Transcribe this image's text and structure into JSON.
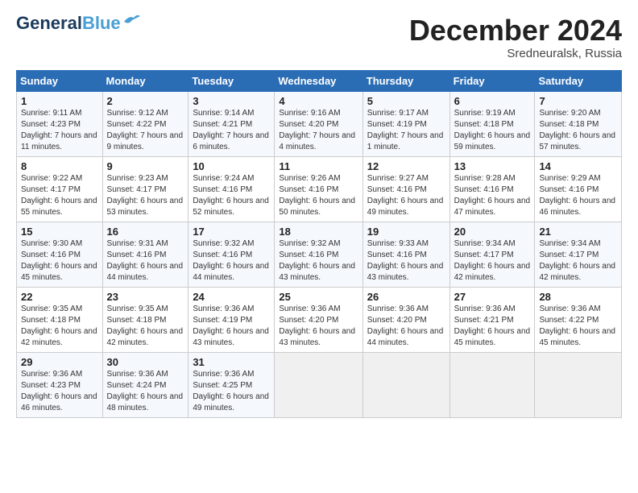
{
  "header": {
    "logo_general": "General",
    "logo_blue": "Blue",
    "month": "December 2024",
    "location": "Sredneuralsk, Russia"
  },
  "weekdays": [
    "Sunday",
    "Monday",
    "Tuesday",
    "Wednesday",
    "Thursday",
    "Friday",
    "Saturday"
  ],
  "weeks": [
    [
      {
        "day": "1",
        "sunrise": "9:11 AM",
        "sunset": "4:23 PM",
        "daylight": "7 hours and 11 minutes."
      },
      {
        "day": "2",
        "sunrise": "9:12 AM",
        "sunset": "4:22 PM",
        "daylight": "7 hours and 9 minutes."
      },
      {
        "day": "3",
        "sunrise": "9:14 AM",
        "sunset": "4:21 PM",
        "daylight": "7 hours and 6 minutes."
      },
      {
        "day": "4",
        "sunrise": "9:16 AM",
        "sunset": "4:20 PM",
        "daylight": "7 hours and 4 minutes."
      },
      {
        "day": "5",
        "sunrise": "9:17 AM",
        "sunset": "4:19 PM",
        "daylight": "7 hours and 1 minute."
      },
      {
        "day": "6",
        "sunrise": "9:19 AM",
        "sunset": "4:18 PM",
        "daylight": "6 hours and 59 minutes."
      },
      {
        "day": "7",
        "sunrise": "9:20 AM",
        "sunset": "4:18 PM",
        "daylight": "6 hours and 57 minutes."
      }
    ],
    [
      {
        "day": "8",
        "sunrise": "9:22 AM",
        "sunset": "4:17 PM",
        "daylight": "6 hours and 55 minutes."
      },
      {
        "day": "9",
        "sunrise": "9:23 AM",
        "sunset": "4:17 PM",
        "daylight": "6 hours and 53 minutes."
      },
      {
        "day": "10",
        "sunrise": "9:24 AM",
        "sunset": "4:16 PM",
        "daylight": "6 hours and 52 minutes."
      },
      {
        "day": "11",
        "sunrise": "9:26 AM",
        "sunset": "4:16 PM",
        "daylight": "6 hours and 50 minutes."
      },
      {
        "day": "12",
        "sunrise": "9:27 AM",
        "sunset": "4:16 PM",
        "daylight": "6 hours and 49 minutes."
      },
      {
        "day": "13",
        "sunrise": "9:28 AM",
        "sunset": "4:16 PM",
        "daylight": "6 hours and 47 minutes."
      },
      {
        "day": "14",
        "sunrise": "9:29 AM",
        "sunset": "4:16 PM",
        "daylight": "6 hours and 46 minutes."
      }
    ],
    [
      {
        "day": "15",
        "sunrise": "9:30 AM",
        "sunset": "4:16 PM",
        "daylight": "6 hours and 45 minutes."
      },
      {
        "day": "16",
        "sunrise": "9:31 AM",
        "sunset": "4:16 PM",
        "daylight": "6 hours and 44 minutes."
      },
      {
        "day": "17",
        "sunrise": "9:32 AM",
        "sunset": "4:16 PM",
        "daylight": "6 hours and 44 minutes."
      },
      {
        "day": "18",
        "sunrise": "9:32 AM",
        "sunset": "4:16 PM",
        "daylight": "6 hours and 43 minutes."
      },
      {
        "day": "19",
        "sunrise": "9:33 AM",
        "sunset": "4:16 PM",
        "daylight": "6 hours and 43 minutes."
      },
      {
        "day": "20",
        "sunrise": "9:34 AM",
        "sunset": "4:17 PM",
        "daylight": "6 hours and 42 minutes."
      },
      {
        "day": "21",
        "sunrise": "9:34 AM",
        "sunset": "4:17 PM",
        "daylight": "6 hours and 42 minutes."
      }
    ],
    [
      {
        "day": "22",
        "sunrise": "9:35 AM",
        "sunset": "4:18 PM",
        "daylight": "6 hours and 42 minutes."
      },
      {
        "day": "23",
        "sunrise": "9:35 AM",
        "sunset": "4:18 PM",
        "daylight": "6 hours and 42 minutes."
      },
      {
        "day": "24",
        "sunrise": "9:36 AM",
        "sunset": "4:19 PM",
        "daylight": "6 hours and 43 minutes."
      },
      {
        "day": "25",
        "sunrise": "9:36 AM",
        "sunset": "4:20 PM",
        "daylight": "6 hours and 43 minutes."
      },
      {
        "day": "26",
        "sunrise": "9:36 AM",
        "sunset": "4:20 PM",
        "daylight": "6 hours and 44 minutes."
      },
      {
        "day": "27",
        "sunrise": "9:36 AM",
        "sunset": "4:21 PM",
        "daylight": "6 hours and 45 minutes."
      },
      {
        "day": "28",
        "sunrise": "9:36 AM",
        "sunset": "4:22 PM",
        "daylight": "6 hours and 45 minutes."
      }
    ],
    [
      {
        "day": "29",
        "sunrise": "9:36 AM",
        "sunset": "4:23 PM",
        "daylight": "6 hours and 46 minutes."
      },
      {
        "day": "30",
        "sunrise": "9:36 AM",
        "sunset": "4:24 PM",
        "daylight": "6 hours and 48 minutes."
      },
      {
        "day": "31",
        "sunrise": "9:36 AM",
        "sunset": "4:25 PM",
        "daylight": "6 hours and 49 minutes."
      },
      null,
      null,
      null,
      null
    ]
  ]
}
